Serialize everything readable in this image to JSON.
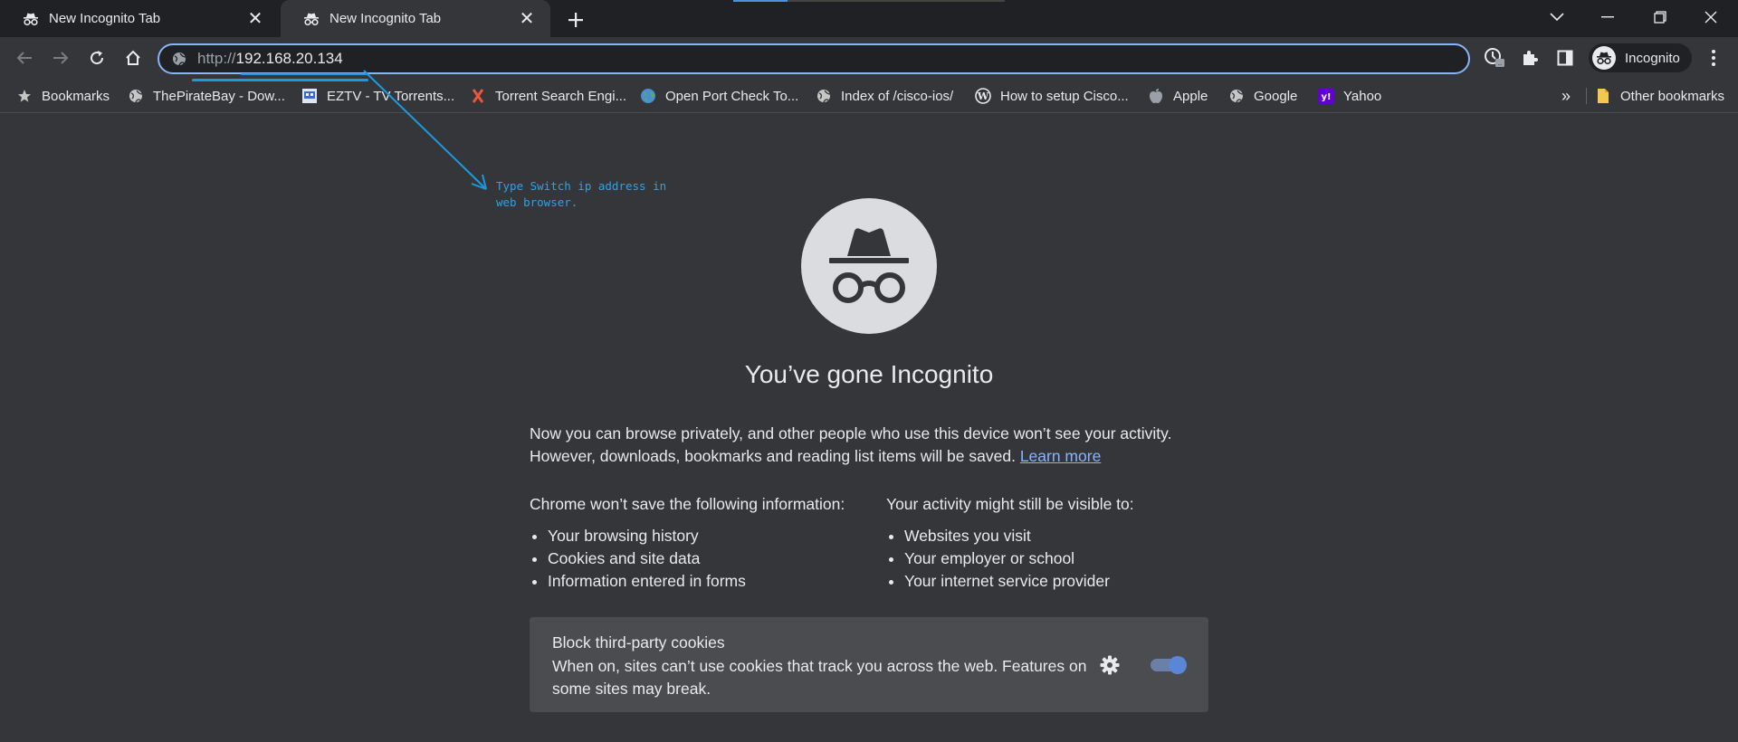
{
  "tabs": [
    {
      "title": "New Incognito Tab",
      "icon": "incognito-icon",
      "active": false
    },
    {
      "title": "New Incognito Tab",
      "icon": "incognito-icon",
      "active": true
    }
  ],
  "omnibox": {
    "scheme": "http://",
    "host": "192.168.20.134",
    "icon": "globe-icon"
  },
  "profile": {
    "label": "Incognito",
    "icon": "incognito-icon"
  },
  "bookmarks": [
    {
      "label": "Bookmarks",
      "icon": "star-icon"
    },
    {
      "label": "ThePirateBay - Dow...",
      "icon": "globe-icon"
    },
    {
      "label": "EZTV - TV Torrents...",
      "icon": "eztv-icon"
    },
    {
      "label": "Torrent Search Engi...",
      "icon": "x-logo-icon"
    },
    {
      "label": "Open Port Check To...",
      "icon": "earth-icon"
    },
    {
      "label": "Index of /cisco-ios/",
      "icon": "globe-icon"
    },
    {
      "label": "How to setup Cisco...",
      "icon": "wordpress-icon"
    },
    {
      "label": "Apple",
      "icon": "apple-icon"
    },
    {
      "label": "Google",
      "icon": "globe-icon"
    },
    {
      "label": "Yahoo",
      "icon": "yahoo-icon"
    }
  ],
  "bookmarks_overflow": "»",
  "other_bookmarks": {
    "label": "Other bookmarks",
    "icon": "folder-icon"
  },
  "annotation": {
    "line1": "Type Switch ip address in",
    "line2": "web browser.",
    "color": "#1a9be0"
  },
  "content": {
    "headline": "You’ve gone Incognito",
    "intro_line1": "Now you can browse privately, and other people who use this device won’t see your activity.",
    "intro_line2": "However, downloads, bookmarks and reading list items will be saved.",
    "learn_more": "Learn more",
    "left_heading": "Chrome won’t save the following information:",
    "left_items": [
      "Your browsing history",
      "Cookies and site data",
      "Information entered in forms"
    ],
    "right_heading": "Your activity might still be visible to:",
    "right_items": [
      "Websites you visit",
      "Your employer or school",
      "Your internet service provider"
    ]
  },
  "cookie_card": {
    "title": "Block third-party cookies",
    "line1": "When on, sites can’t use cookies that track you across the web. Features on",
    "line2": "some sites may break.",
    "toggle_on": true
  },
  "colors": {
    "background": "#35363a",
    "tabstrip": "#202124",
    "accent": "#8ab4f8",
    "annotation": "#1a9be0"
  }
}
